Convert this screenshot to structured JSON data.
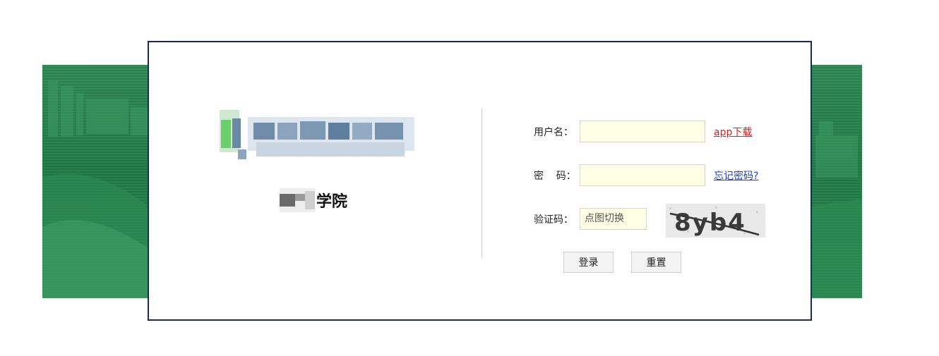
{
  "school": {
    "logo_text": "学院",
    "logo_mark": "school-logo"
  },
  "form": {
    "username_label": "用户名：",
    "password_label": "密    码：",
    "captcha_label": "验证码：",
    "username_value": "",
    "password_value": "",
    "captcha_placeholder": "点图切换",
    "captcha_image_text": "8yb4",
    "app_link": "app下载",
    "forgot_link": "忘记密码?",
    "login_button": "登录",
    "reset_button": "重置"
  },
  "colors": {
    "banner": "#1f7a44",
    "card_border": "#1a2a5a",
    "input_bg": "#ffffe6",
    "link_red": "#e0201e",
    "link_blue": "#1b3fd6"
  }
}
